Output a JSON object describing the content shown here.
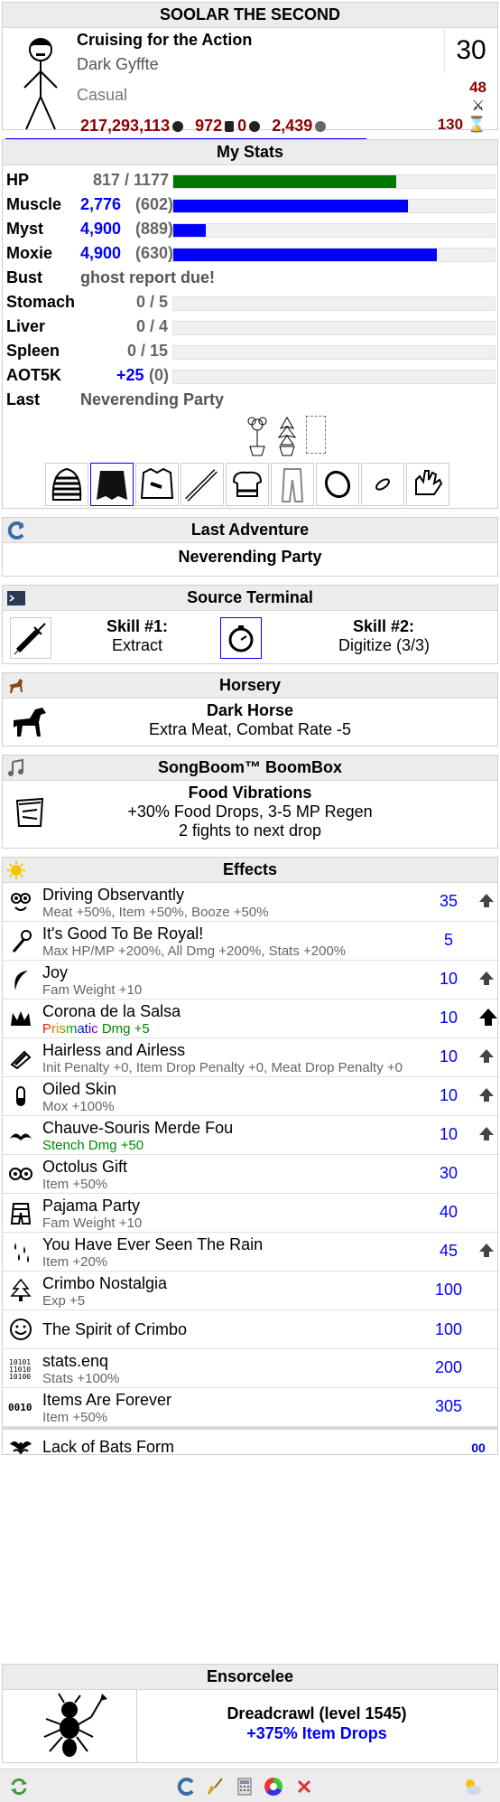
{
  "character": {
    "name": "SOOLAR THE SECOND",
    "title": "Cruising for the Action",
    "class": "Dark Gyffte",
    "path": "Casual",
    "level": "30",
    "adventures_pvp": "48",
    "turns": "130",
    "meat": "217,293,113",
    "currency2": "972",
    "currency3": "0",
    "currency4": "2,439",
    "xp_progress": 0.72
  },
  "stats": {
    "header": "My Stats",
    "rows": [
      {
        "label": "HP",
        "value": "817 / 1177",
        "fill": 0.694,
        "color": "green"
      },
      {
        "label": "Muscle",
        "value": "2,776",
        "base": "(602)",
        "fill": 0.73
      },
      {
        "label": "Myst",
        "value": "4,900",
        "base": "(889)",
        "fill": 0.1
      },
      {
        "label": "Moxie",
        "value": "4,900",
        "base": "(630)",
        "fill": 0.82
      }
    ],
    "bust_label": "Bust",
    "bust_value": "ghost report due!",
    "organs": [
      {
        "label": "Stomach",
        "value": "0 / 5"
      },
      {
        "label": "Liver",
        "value": "0 / 4"
      },
      {
        "label": "Spleen",
        "value": "0 / 15"
      },
      {
        "label": "AOT5K",
        "value": "+25",
        "extra": "(0)"
      }
    ],
    "last_label": "Last",
    "last_value": "Neverending Party"
  },
  "last_adventure": {
    "header": "Last Adventure",
    "location": "Neverending Party"
  },
  "source_terminal": {
    "header": "Source Terminal",
    "skill1_label": "Skill #1:",
    "skill1": "Extract",
    "skill2_label": "Skill #2:",
    "skill2": "Digitize (3/3)"
  },
  "horsery": {
    "header": "Horsery",
    "horse": "Dark Horse",
    "effect": "Extra Meat, Combat Rate -5"
  },
  "boombox": {
    "header": "SongBoom™ BoomBox",
    "song": "Food Vibrations",
    "effect": "+30% Food Drops, 3-5 MP Regen",
    "next": "2 fights to next drop"
  },
  "effects": {
    "header": "Effects",
    "list": [
      {
        "name": "Driving Observantly",
        "desc": "Meat +50%, Item +50%, Booze +50%",
        "dur": "35",
        "up": "small",
        "icon": "eyes-icon"
      },
      {
        "name": "It's Good To Be Royal!",
        "desc": "Max HP/MP +200%, All Dmg +200%, Stats +200%",
        "dur": "5",
        "up": "",
        "icon": "scepter-icon"
      },
      {
        "name": "Joy",
        "desc": "Fam Weight +10",
        "dur": "10",
        "up": "small",
        "icon": "crescent-icon"
      },
      {
        "name": "Corona de la Salsa",
        "desc_prefix": "Prismatic",
        "desc": " Dmg +5",
        "dur": "10",
        "up": "big",
        "icon": "crown-icon"
      },
      {
        "name": "Hairless and Airless",
        "desc": "Init Penalty +0, Item Drop Penalty +0, Meat Drop Penalty +0",
        "dur": "10",
        "up": "small",
        "icon": "razor-icon"
      },
      {
        "name": "Oiled Skin",
        "desc": "Mox +100%",
        "dur": "10",
        "up": "small",
        "icon": "vial-icon"
      },
      {
        "name": "Chauve-Souris Merde Fou",
        "desc": "Stench Dmg +50",
        "dur": "10",
        "up": "small",
        "icon": "mustache-icon",
        "green": true
      },
      {
        "name": "Octolus Gift",
        "desc": "Item +50%",
        "dur": "30",
        "up": "",
        "icon": "goggles-icon"
      },
      {
        "name": "Pajama Party",
        "desc": "Fam Weight +10",
        "dur": "40",
        "up": "",
        "icon": "pajamas-icon"
      },
      {
        "name": "You Have Ever Seen The Rain",
        "desc": "Item +20%",
        "dur": "45",
        "up": "small",
        "icon": "raindrops-icon"
      },
      {
        "name": "Crimbo Nostalgia",
        "desc": "Exp +5",
        "dur": "100",
        "up": "",
        "icon": "tree-icon"
      },
      {
        "name": "The Spirit of Crimbo",
        "desc": "",
        "dur": "100",
        "up": "",
        "icon": "smiley-icon"
      },
      {
        "name": "stats.enq",
        "desc": "Stats +100%",
        "dur": "200",
        "up": "",
        "icon": "binary-icon"
      },
      {
        "name": "Items Are Forever",
        "desc": "Item +50%",
        "dur": "305",
        "up": "",
        "icon": "rings-icon"
      }
    ],
    "intrinsic": {
      "name": "Lack of Bats Form",
      "dur": "00"
    }
  },
  "familiar": {
    "header": "Ensorcelee",
    "name": "Dreadcrawl (level 1545)",
    "effect": "+375% Item Drops"
  },
  "colors": {
    "blue": "#0000ff",
    "darkred": "#8b0000",
    "header_bg": "#ececec"
  }
}
